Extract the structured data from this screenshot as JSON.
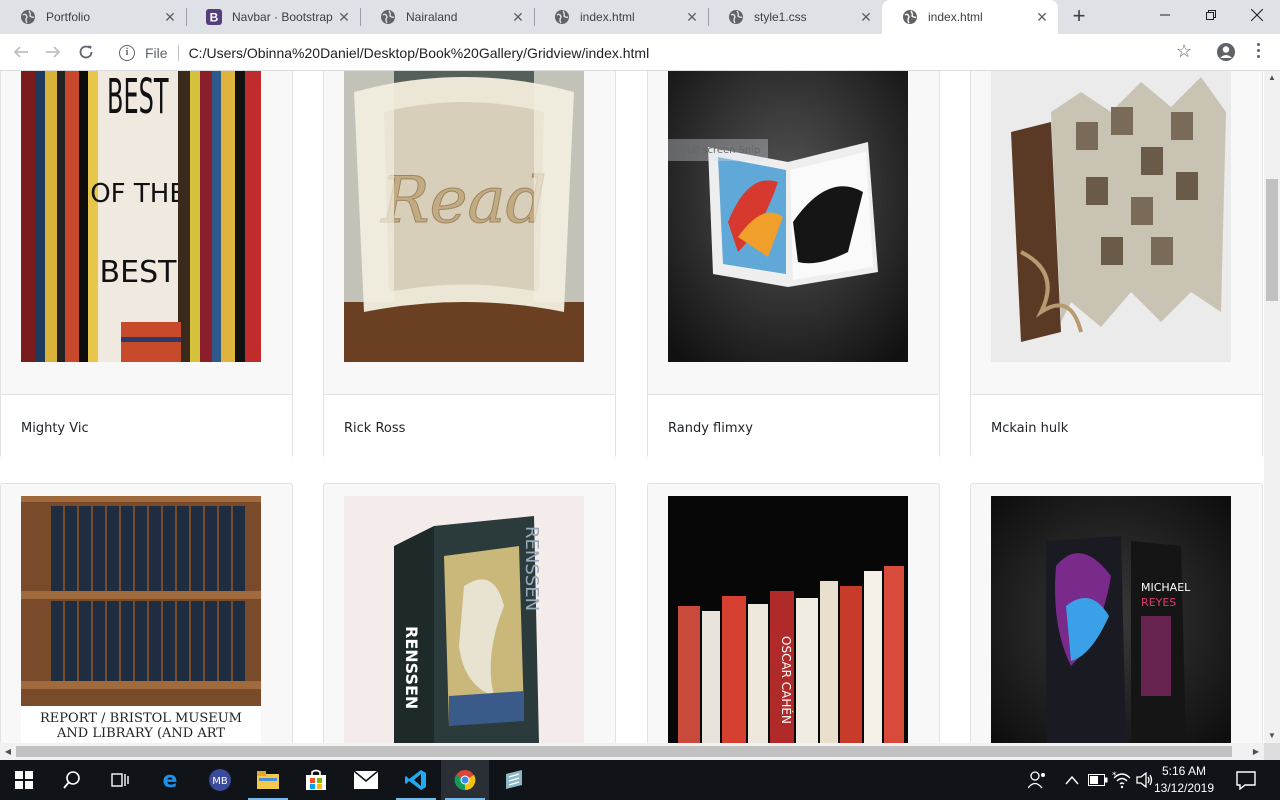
{
  "browser": {
    "tabs": [
      {
        "title": "Portfolio",
        "icon": "globe-icon"
      },
      {
        "title": "Navbar · Bootstrap",
        "icon": "bootstrap-icon"
      },
      {
        "title": "Nairaland",
        "icon": "globe-icon"
      },
      {
        "title": "index.html",
        "icon": "globe-icon"
      },
      {
        "title": "style1.css",
        "icon": "globe-icon"
      },
      {
        "title": "index.html",
        "icon": "globe-icon",
        "active": true
      }
    ],
    "address": {
      "scheme_label": "File",
      "url": "C:/Users/Obinna%20Daniel/Desktop/Book%20Gallery/Gridview/index.html"
    }
  },
  "gallery": {
    "cards": [
      {
        "caption": "Mighty Vic",
        "image": "bookshelf-best-of-the-best",
        "overlay_text": "BEST OF THE BEST"
      },
      {
        "caption": "Rick Ross",
        "image": "folded-book-read",
        "overlay_text": "Read"
      },
      {
        "caption": "Randy flimxy",
        "image": "open-book-sneaker",
        "overlay_text": "Full screen Snip"
      },
      {
        "caption": "Mckain hulk",
        "image": "accordion-photo-book",
        "overlay_text": ""
      },
      {
        "caption": "",
        "image": "library-shelves",
        "overlay_text": "REPORT / BRISTOL MUSEUM AND LIBRARY (AND ART GALLERY)"
      },
      {
        "caption": "",
        "image": "renssen-book",
        "overlay_text": "RENSSEN"
      },
      {
        "caption": "",
        "image": "book-spines-black",
        "overlay_text": "OSCAR CAHÉN"
      },
      {
        "caption": "",
        "image": "dark-open-book",
        "overlay_text": "MICHAEL REYES"
      }
    ]
  },
  "taskbar": {
    "apps": [
      "windows-start-icon",
      "search-icon",
      "task-view-icon",
      "edge-icon",
      "malwarebytes-icon",
      "file-explorer-icon",
      "store-icon",
      "mail-icon",
      "vscode-icon",
      "chrome-icon",
      "sublime-icon"
    ],
    "clock_time": "5:16 AM",
    "clock_date": "13/12/2019"
  },
  "colors": {
    "accent": "#76b9ed",
    "taskbar": "#101418",
    "tabstrip": "#dee1e6"
  }
}
